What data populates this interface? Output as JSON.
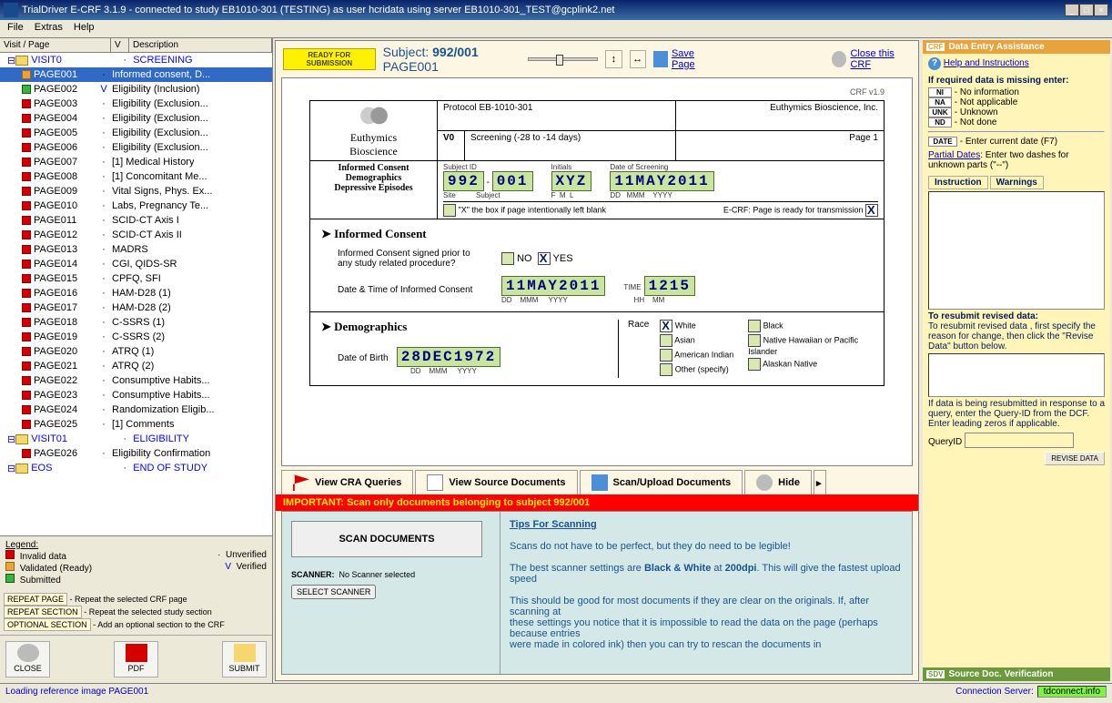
{
  "title": "TrialDriver E-CRF 3.1.9 - connected to study EB1010-301 (TESTING) as user hcridata using server EB1010-301_TEST@gcplink2.net",
  "menu": {
    "file": "File",
    "extras": "Extras",
    "help": "Help"
  },
  "tree_headers": {
    "visitpage": "Visit / Page",
    "v": "V",
    "desc": "Description"
  },
  "tree": [
    {
      "type": "visit",
      "label": "VISIT0",
      "desc": "SCREENING"
    },
    {
      "sq": "orange",
      "label": "PAGE001",
      "v": "·",
      "desc": "Informed consent, D...",
      "sel": true
    },
    {
      "sq": "green",
      "label": "PAGE002",
      "v": "V",
      "desc": "Eligibility (Inclusion)"
    },
    {
      "sq": "red",
      "label": "PAGE003",
      "v": "·",
      "desc": "Eligibility (Exclusion..."
    },
    {
      "sq": "red",
      "label": "PAGE004",
      "v": "·",
      "desc": "Eligibility (Exclusion..."
    },
    {
      "sq": "red",
      "label": "PAGE005",
      "v": "·",
      "desc": "Eligibility (Exclusion..."
    },
    {
      "sq": "red",
      "label": "PAGE006",
      "v": "·",
      "desc": "Eligibility (Exclusion..."
    },
    {
      "sq": "red",
      "label": "PAGE007",
      "v": "·",
      "desc": "[1] Medical History"
    },
    {
      "sq": "red",
      "label": "PAGE008",
      "v": "·",
      "desc": "[1] Concomitant Me..."
    },
    {
      "sq": "red",
      "label": "PAGE009",
      "v": "·",
      "desc": "Vital Signs, Phys. Ex..."
    },
    {
      "sq": "red",
      "label": "PAGE010",
      "v": "·",
      "desc": "Labs, Pregnancy Te..."
    },
    {
      "sq": "red",
      "label": "PAGE011",
      "v": "·",
      "desc": "SCID-CT Axis I"
    },
    {
      "sq": "red",
      "label": "PAGE012",
      "v": "·",
      "desc": "SCID-CT Axis II"
    },
    {
      "sq": "red",
      "label": "PAGE013",
      "v": "·",
      "desc": "MADRS"
    },
    {
      "sq": "red",
      "label": "PAGE014",
      "v": "·",
      "desc": "CGI, QIDS-SR"
    },
    {
      "sq": "red",
      "label": "PAGE015",
      "v": "·",
      "desc": "CPFQ, SFI"
    },
    {
      "sq": "red",
      "label": "PAGE016",
      "v": "·",
      "desc": "HAM-D28 (1)"
    },
    {
      "sq": "red",
      "label": "PAGE017",
      "v": "·",
      "desc": "HAM-D28 (2)"
    },
    {
      "sq": "red",
      "label": "PAGE018",
      "v": "·",
      "desc": "C-SSRS (1)"
    },
    {
      "sq": "red",
      "label": "PAGE019",
      "v": "·",
      "desc": "C-SSRS (2)"
    },
    {
      "sq": "red",
      "label": "PAGE020",
      "v": "·",
      "desc": "ATRQ (1)"
    },
    {
      "sq": "red",
      "label": "PAGE021",
      "v": "·",
      "desc": "ATRQ (2)"
    },
    {
      "sq": "red",
      "label": "PAGE022",
      "v": "·",
      "desc": "Consumptive Habits..."
    },
    {
      "sq": "red",
      "label": "PAGE023",
      "v": "·",
      "desc": "Consumptive Habits..."
    },
    {
      "sq": "red",
      "label": "PAGE024",
      "v": "·",
      "desc": "Randomization Eligib..."
    },
    {
      "sq": "red",
      "label": "PAGE025",
      "v": "·",
      "desc": "[1] Comments"
    },
    {
      "type": "visit",
      "label": "VISIT01",
      "desc": "ELIGIBILITY"
    },
    {
      "sq": "red",
      "label": "PAGE026",
      "v": "·",
      "desc": "Eligibility Confirmation"
    },
    {
      "type": "eos",
      "label": "EOS",
      "desc": "END OF STUDY"
    }
  ],
  "legend": {
    "title": "Legend:",
    "invalid": "Invalid data",
    "unverified": "Unverified",
    "validated": "Validated (Ready)",
    "verified": "Verified",
    "submitted": "Submitted"
  },
  "lbuttons": {
    "repeat_page": "REPEAT PAGE",
    "repeat_page_desc": "- Repeat the selected CRF page",
    "repeat_section": "REPEAT SECTION",
    "repeat_section_desc": "- Repeat the selected study section",
    "optional_section": "OPTIONAL SECTION",
    "optional_section_desc": "- Add an optional section to the CRF"
  },
  "big": {
    "close": "CLOSE",
    "pdf": "PDF",
    "submit": "SUBMIT"
  },
  "hdr": {
    "ready": "READY FOR SUBMISSION",
    "subject_lbl": "Subject:",
    "subject_val": "992/001",
    "page": "PAGE001",
    "save": "Save Page",
    "close": "Close this CRF"
  },
  "crf": {
    "ver": "CRF v1.9",
    "brand1": "Euthymics",
    "brand2": "Bioscience",
    "protocol": "Protocol EB-1010-301",
    "company": "Euthymics Bioscience, Inc.",
    "v0": "V0",
    "v0desc": "Screening (-28 to -14 days)",
    "pageno": "Page 1",
    "title1": "Informed Consent",
    "title2": "Demographics",
    "title3": "Depressive Episodes",
    "subjid_lbl": "Subject ID",
    "initials_lbl": "Initials",
    "dos_lbl": "Date of Screening",
    "site": "992",
    "subj": "001",
    "initials": "XYZ",
    "dos": "11MAY2011",
    "xnote": "\"X\" the box if page intentionally left blank",
    "ecrf_note": "E-CRF: Page is ready for transmission",
    "sec1": "Informed Consent",
    "q1": "Informed Consent signed prior to any study related procedure?",
    "no": "NO",
    "yes": "YES",
    "q2": "Date & Time of Informed Consent",
    "icdate": "11MAY2011",
    "ictime": "1215",
    "time_lbl": "TIME",
    "sec2": "Demographics",
    "dob_lbl": "Date of Birth",
    "dob": "28DEC1972",
    "race_lbl": "Race",
    "races": [
      "White",
      "Asian",
      "American Indian",
      "Other (specify)",
      "Black",
      "Native Hawaiian or Pacific Islander",
      "Alaskan Native"
    ]
  },
  "tabs": {
    "cra": "View CRA Queries",
    "src": "View Source Documents",
    "scan": "Scan/Upload Documents",
    "hide": "Hide"
  },
  "redbar": "IMPORTANT: Scan only documents belonging to subject   992/001",
  "scan": {
    "btn": "SCAN DOCUMENTS",
    "scanner_lbl": "SCANNER:",
    "scanner_val": "No Scanner selected",
    "select": "SELECT SCANNER",
    "tips_title": "Tips For Scanning",
    "tip1": "Scans do not have to be perfect, but they do need to be legible!",
    "tip2a": "The best scanner settings are ",
    "tip2b": "Black & White",
    "tip2c": " at ",
    "tip2d": "200dpi",
    "tip2e": ". This will give the fastest upload speed",
    "tip3": "This should be good for most documents if they are clear on the originals. If, after scanning at",
    "tip4": "these settings you notice that it is impossible to read the data on the page (perhaps because entries",
    "tip5": "were made in colored ink) then you can try to rescan the documents in"
  },
  "right": {
    "head": "Data Entry Assistance",
    "help": "Help and Instructions",
    "missing": "If required data is missing enter:",
    "ni": "NI",
    "ni_d": "- No information",
    "na": "NA",
    "na_d": "- Not applicable",
    "unk": "UNK",
    "unk_d": "- Unknown",
    "nd": "ND",
    "nd_d": "- Not done",
    "date": "DATE",
    "date_d": "- Enter current date (F7)",
    "partial": "Partial Dates",
    "partial_d": ": Enter two dashes for unknown parts (\"--\")",
    "tab1": "Instruction",
    "tab2": "Warnings",
    "resubmit_t": "To resubmit revised data:",
    "resubmit_d": "To resubmit revised data , first specify the reason for change, then click the \"Revise Data\" button below.",
    "query_note": "If data is being resubmitted in response to a query, enter the Query-ID from the DCF. Enter leading zeros if applicable.",
    "queryid": "QueryID",
    "revise": "REVISE DATA",
    "sdv": "Source Doc. Verification"
  },
  "status": {
    "loading": "Loading reference image PAGE001",
    "conn": "Connection Server:",
    "server": "tdconnect.info"
  }
}
